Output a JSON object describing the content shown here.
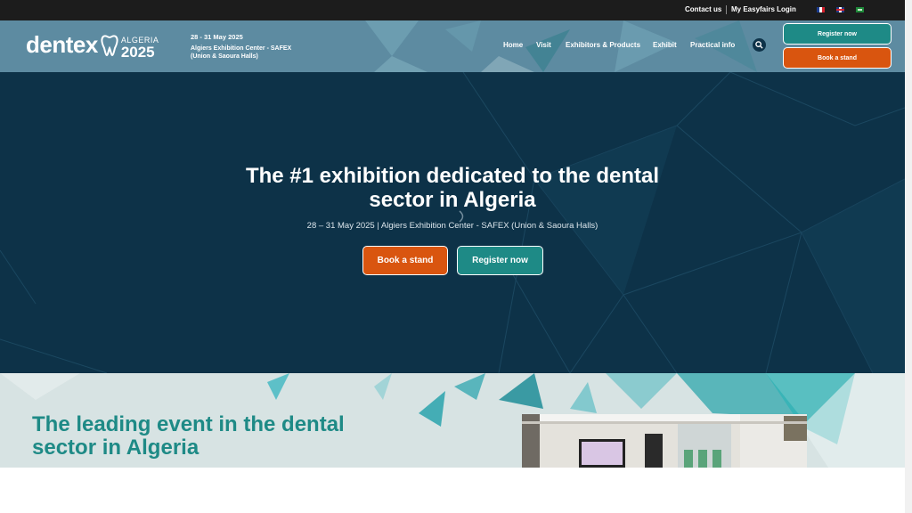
{
  "topbar": {
    "contact": "Contact us",
    "login": "My Easyfairs Login",
    "languages": [
      "fr",
      "en",
      "ar"
    ]
  },
  "logo": {
    "word": "dentex",
    "country": "ALGERIA",
    "year": "2025"
  },
  "event": {
    "dates": "28 - 31 May 2025",
    "venue_line1": "Algiers Exhibition Center - SAFEX",
    "venue_line2": "(Union & Saoura Halls)"
  },
  "nav": {
    "items": [
      "Home",
      "Visit",
      "Exhibitors & Products",
      "Exhibit",
      "Practical info"
    ]
  },
  "header_buttons": {
    "register": "Register now",
    "stand": "Book a stand"
  },
  "hero": {
    "title": "The #1 exhibition dedicated to the dental sector in Algeria",
    "subtitle": "28 – 31 May 2025 | Algiers Exhibition Center - SAFEX (Union & Saoura Halls)",
    "btn_stand": "Book a stand",
    "btn_register": "Register now"
  },
  "section2": {
    "title": "The leading event in the dental sector in Algeria"
  },
  "colors": {
    "topbar": "#1c1c1c",
    "header": "#5d8ba1",
    "hero": "#0d3248",
    "teal": "#1e8a86",
    "orange": "#d9550f"
  }
}
